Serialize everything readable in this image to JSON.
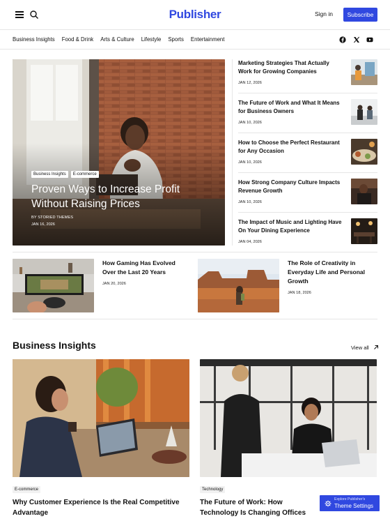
{
  "header": {
    "logo": "Publisher",
    "sign_in": "Sign in",
    "subscribe": "Subscribe"
  },
  "nav": {
    "items": [
      "Business Insights",
      "Food & Drink",
      "Arts & Culture",
      "Lifestyle",
      "Sports",
      "Entertainment"
    ],
    "social_icons": [
      "facebook-icon",
      "x-icon",
      "youtube-icon"
    ]
  },
  "hero": {
    "tags": [
      "Business Insights",
      "E-commerce"
    ],
    "title": "Proven Ways to Increase Profit Without Raising Prices",
    "author": "BY STORIED THEMES",
    "date": "JAN 16, 2026"
  },
  "right_list": [
    {
      "title": "Marketing Strategies That Actually Work for Growing Companies",
      "date": "JAN 12, 2026"
    },
    {
      "title": "The Future of Work and What It Means for Business Owners",
      "date": "JAN 10, 2026"
    },
    {
      "title": "How to Choose the Perfect Restaurant for Any Occasion",
      "date": "JAN 10, 2026"
    },
    {
      "title": "How Strong Company Culture Impacts Revenue Growth",
      "date": "JAN 10, 2026"
    },
    {
      "title": "The Impact of Music and Lighting Have On Your Dining Experience",
      "date": "JAN 04, 2026"
    }
  ],
  "mid_row": [
    {
      "title": "How Gaming Has Evolved Over the Last 20 Years",
      "date": "JAN 20, 2026"
    },
    {
      "title": "The Role of Creativity in Everyday Life and Personal Growth",
      "date": "JAN 18, 2026"
    }
  ],
  "section": {
    "title": "Business Insights",
    "view_all": "View all"
  },
  "cards": [
    {
      "tag": "E-commerce",
      "title": "Why Customer Experience Is the Real Competitive Advantage"
    },
    {
      "tag": "Technology",
      "title": "The Future of Work: How Technology Is Changing Offices"
    }
  ],
  "theme_button": {
    "subtitle": "Explore Publisher's",
    "label": "Theme Settings"
  },
  "colors": {
    "brand": "#3048e0"
  }
}
